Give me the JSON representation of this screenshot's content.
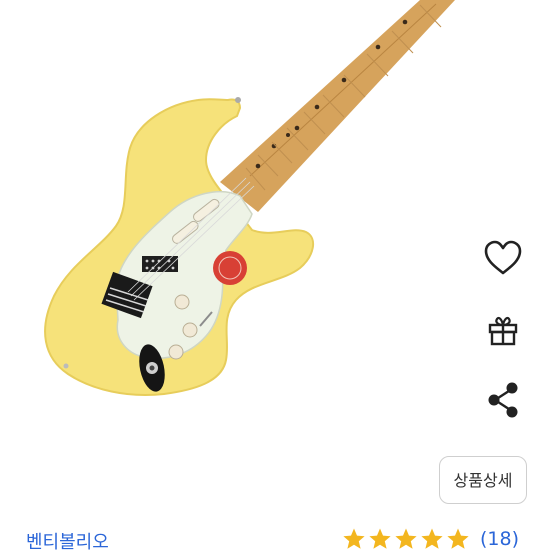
{
  "product": {
    "brand": "벤티볼리오",
    "rating": 5,
    "review_count": "(18)"
  },
  "actions": {
    "wishlist_icon": "heart-outline-icon",
    "gift_icon": "gift-icon",
    "share_icon": "share-icon",
    "detail_label": "상품상세"
  },
  "colors": {
    "body": "#f6e27a",
    "link": "#2b66d8",
    "star": "#f3b61f"
  }
}
